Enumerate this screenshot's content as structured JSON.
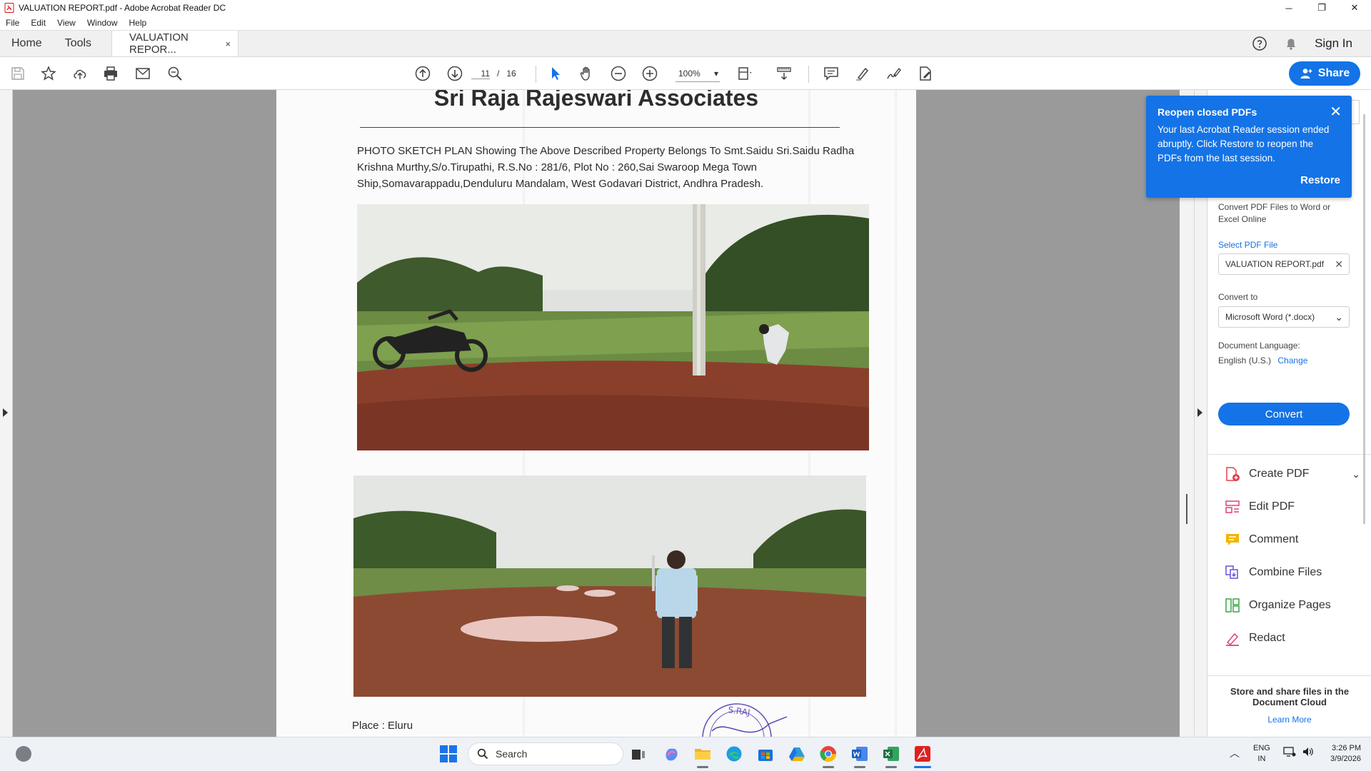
{
  "window": {
    "title": "VALUATION REPORT.pdf - Adobe Acrobat Reader DC",
    "minimize": "─",
    "restore": "❐",
    "close": "✕"
  },
  "menu": [
    "File",
    "Edit",
    "View",
    "Window",
    "Help"
  ],
  "tabs": {
    "home": "Home",
    "tools": "Tools",
    "document": "VALUATION REPOR...",
    "document_close": "×"
  },
  "header_right": {
    "help_icon": "help-icon",
    "bell_icon": "notification-bell-icon",
    "sign_in": "Sign In"
  },
  "toolbar": {
    "current_page": "11",
    "page_separator": "/",
    "total_pages": "16",
    "zoom": "100%",
    "zoom_caret": "▾",
    "share_label": "Share"
  },
  "document": {
    "heading": "Sri Raja Rajeswari Associates",
    "body_lines": [
      "PHOTO  SKETCH PLAN Showing The Above Described Property Belongs To  Smt.Saidu Sri.Saidu Radha",
      "Krishna Murthy,S/o.Tirupathi, R.S.No :     281/6, Plot No : 260,Sai Swaroop Mega Town",
      "Ship,Somavarappadu,Denduluru Mandalam, West Godavari District, Andhra Pradesh."
    ],
    "place": "Place : Eluru",
    "stamp_text": "S.RAJ"
  },
  "notification": {
    "title": "Reopen closed PDFs",
    "body": "Your last Acrobat Reader session ended abruptly. Click Restore to reopen the PDFs from the last session.",
    "close": "✕",
    "action": "Restore"
  },
  "tools_panel": {
    "description": "Convert PDF Files to Word or Excel Online",
    "select_file_label": "Select PDF File",
    "selected_file": "VALUATION REPORT.pdf",
    "file_clear": "✕",
    "convert_to_label": "Convert to",
    "convert_to_value": "Microsoft Word (*.docx)",
    "convert_to_caret": "⌄",
    "document_language_label": "Document Language:",
    "document_language_value": "English (U.S.)",
    "change_link": "Change",
    "convert_button": "Convert",
    "tools": [
      {
        "label": "Create PDF",
        "icon": "create-pdf-icon",
        "color": "#e0404a"
      },
      {
        "label": "Edit PDF",
        "icon": "edit-pdf-icon",
        "color": "#e0407a"
      },
      {
        "label": "Comment",
        "icon": "comment-icon",
        "color": "#f2b500"
      },
      {
        "label": "Combine Files",
        "icon": "combine-files-icon",
        "color": "#6b4fd8"
      },
      {
        "label": "Organize Pages",
        "icon": "organize-pages-icon",
        "color": "#3aa54a"
      },
      {
        "label": "Redact",
        "icon": "redact-icon",
        "color": "#e0407a"
      }
    ],
    "create_pdf_chevron": "⌄",
    "cloud_text": "Store and share files in the Document Cloud",
    "learn_more": "Learn More"
  },
  "taskbar": {
    "search_placeholder": "Search",
    "apps": [
      "task-view-icon",
      "copilot-icon",
      "file-explorer-icon",
      "edge-icon",
      "microsoft-store-icon",
      "drive-icon",
      "chrome-icon",
      "word-icon",
      "excel-icon",
      "acrobat-icon"
    ],
    "chevron": "︿",
    "lang_line1": "ENG",
    "lang_line2": "IN",
    "time": "3:26 PM",
    "date": "3/9/2026"
  },
  "colors": {
    "accent": "#1473e6",
    "doc_background": "#9a9a9a",
    "taskbar": "#eef1f6"
  }
}
